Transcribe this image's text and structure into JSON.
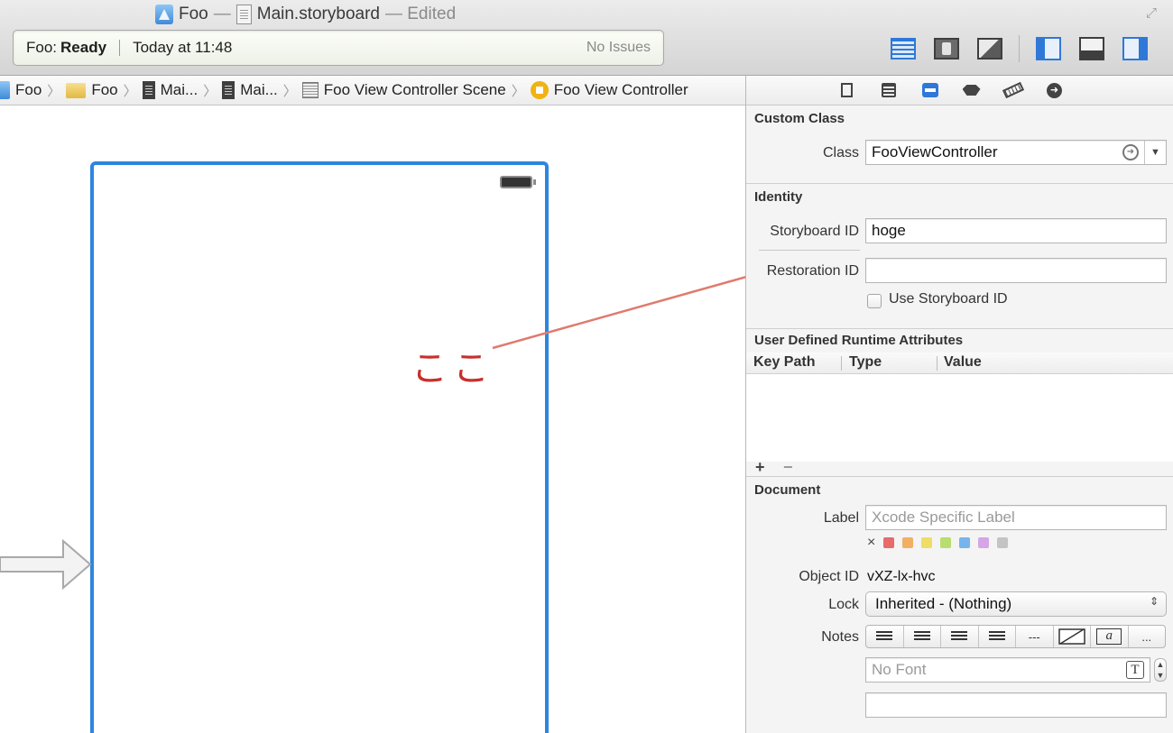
{
  "window": {
    "project": "Foo",
    "dash": "—",
    "file": "Main.storyboard",
    "status": "— Edited"
  },
  "activity": {
    "scheme": "Foo:",
    "state": "Ready",
    "time": "Today at 11:48",
    "issues": "No Issues"
  },
  "jumpbar": {
    "items": [
      "Foo",
      "Foo",
      "Mai...",
      "Mai...",
      "Foo View Controller Scene",
      "Foo View Controller"
    ],
    "separator": "〉"
  },
  "canvas": {
    "annotation": "ここ"
  },
  "inspector": {
    "custom_class": {
      "title": "Custom Class",
      "class_label": "Class",
      "class_value": "FooViewController"
    },
    "identity": {
      "title": "Identity",
      "storyboard_id_label": "Storyboard ID",
      "storyboard_id_value": "hoge",
      "restoration_id_label": "Restoration ID",
      "restoration_id_value": "",
      "use_storyboard_id_label": "Use Storyboard ID"
    },
    "runtime_attrs": {
      "title": "User Defined Runtime Attributes",
      "columns": [
        "Key Path",
        "Type",
        "Value"
      ],
      "add": "+",
      "remove": "−"
    },
    "document": {
      "title": "Document",
      "label_label": "Label",
      "label_placeholder": "Xcode Specific Label",
      "clear_mark": "×",
      "label_colors": [
        "#e86a6a",
        "#f1b063",
        "#eedd67",
        "#b9dd6e",
        "#76b5ec",
        "#d5a6e6",
        "#c4c4c4"
      ],
      "object_id_label": "Object ID",
      "object_id_value": "vXZ-lx-hvc",
      "lock_label": "Lock",
      "lock_value": "Inherited - (Nothing)",
      "notes_label": "Notes",
      "notes_dash": "---",
      "notes_char": "a",
      "notes_more": "...",
      "font_placeholder": "No Font",
      "font_icon": "T"
    }
  },
  "colors": {
    "accent": "#2c86e0",
    "annotation": "#c7302c",
    "arrow": "#e07a6e"
  }
}
